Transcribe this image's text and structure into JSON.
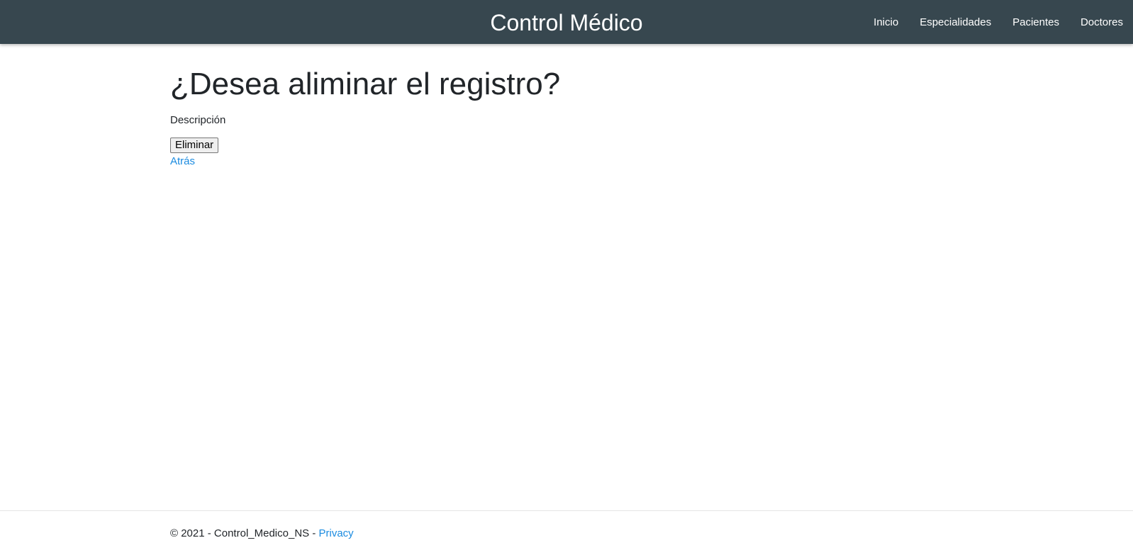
{
  "header": {
    "brand": "Control Médico",
    "nav_items": [
      {
        "label": "Inicio"
      },
      {
        "label": "Especialidades"
      },
      {
        "label": "Pacientes"
      },
      {
        "label": "Doctores"
      }
    ]
  },
  "main": {
    "title": "¿Desea aliminar el registro?",
    "field_label": "Descripción",
    "delete_button": "Eliminar",
    "back_link": "Atrás"
  },
  "footer": {
    "text": "© 2021 - Control_Medico_NS - ",
    "privacy_link": "Privacy"
  },
  "colors": {
    "navbar": "#37474f",
    "link": "#1b8be0",
    "text": "#212529"
  }
}
